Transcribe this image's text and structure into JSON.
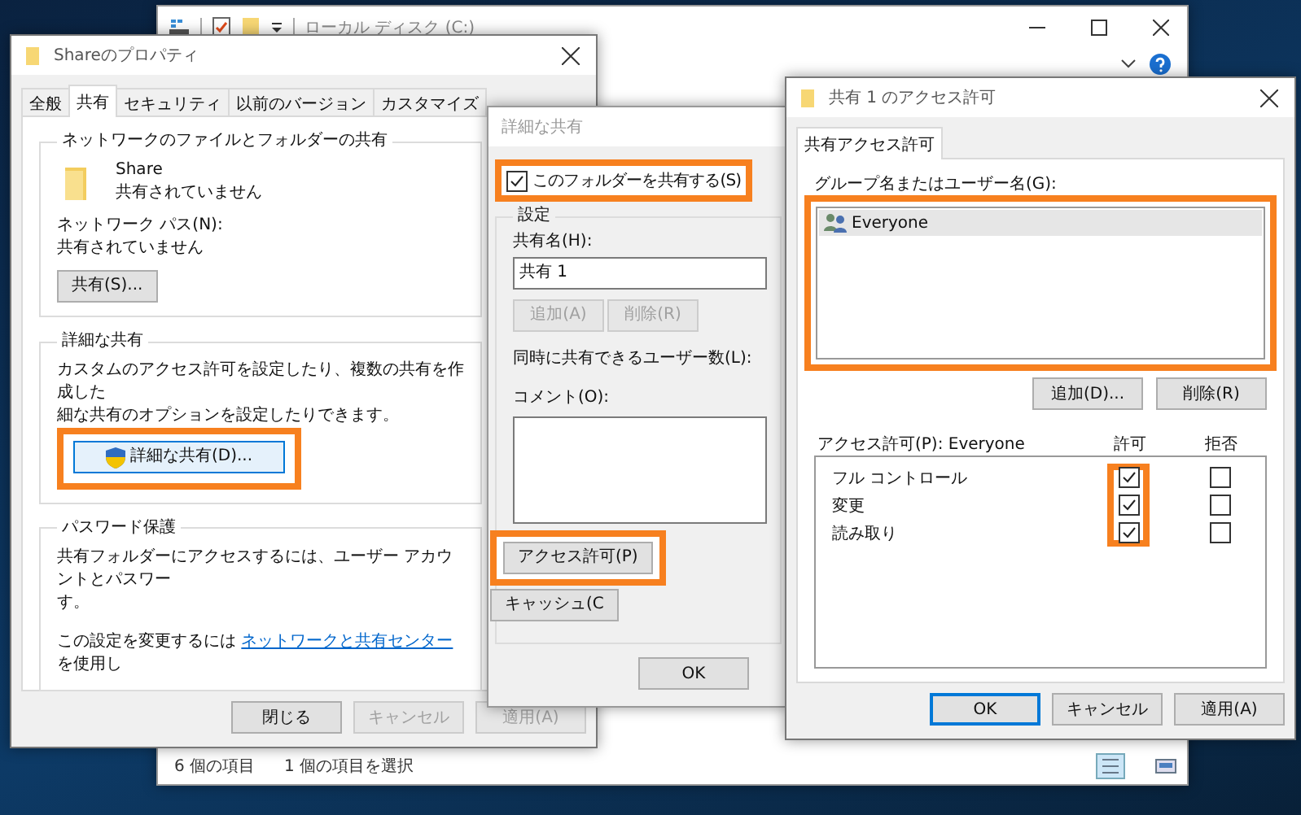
{
  "explorer": {
    "title": "ローカル ディスク (C:)",
    "status_items": [
      "6 個の項目",
      "1 個の項目を選択"
    ]
  },
  "properties": {
    "title": "Shareのプロパティ",
    "tabs": [
      {
        "label": "全般",
        "selected": false
      },
      {
        "label": "共有",
        "selected": true
      },
      {
        "label": "セキュリティ",
        "selected": false
      },
      {
        "label": "以前のバージョン",
        "selected": false
      },
      {
        "label": "カスタマイズ",
        "selected": false
      }
    ],
    "network_group": {
      "title": "ネットワークのファイルとフォルダーの共有",
      "folder_name": "Share",
      "folder_status": "共有されていません",
      "path_label": "ネットワーク パス(N):",
      "path_value": "共有されていません",
      "button": "共有(S)..."
    },
    "advanced_group": {
      "title": "詳細な共有",
      "description": [
        "カスタムのアクセス許可を設定したり、複数の共有を作成した",
        "細な共有のオプションを設定したりできます。"
      ],
      "button": {
        "label": "詳細な共有(D)...",
        "highlighted": true
      }
    },
    "password_group": {
      "title": "パスワード保護",
      "description": [
        "共有フォルダーにアクセスするには、ユーザー アカウントとパスワー",
        "す。"
      ],
      "change_text": "この設定を変更するには",
      "link": "ネットワークと共有センター",
      "change_suffix": "を使用し"
    },
    "buttons": [
      {
        "label": "閉じる",
        "disabled": false
      },
      {
        "label": "キャンセル",
        "disabled": true
      },
      {
        "label": "適用(A)",
        "disabled": true
      }
    ]
  },
  "advanced_dialog": {
    "title": "詳細な共有",
    "share_checkbox": {
      "label": "このフォルダーを共有する(S)",
      "checked": true,
      "highlighted": true
    },
    "settings_title": "設定",
    "share_name_label": "共有名(H):",
    "share_name_value": "共有 1",
    "name_buttons": [
      {
        "label": "追加(A)",
        "disabled": true
      },
      {
        "label": "削除(R)",
        "disabled": true
      }
    ],
    "user_limit_label": "同時に共有できるユーザー数(L):",
    "comment_label": "コメント(O):",
    "permission_button": {
      "label": "アクセス許可(P)",
      "highlighted": true
    },
    "cache_button": "キャッシュ(C",
    "ok_button": "OK"
  },
  "permissions_dialog": {
    "title": "共有 1 のアクセス許可",
    "tab": "共有アクセス許可",
    "group_label": "グループ名またはユーザー名(G):",
    "users": [
      {
        "name": "Everyone",
        "selected": true
      }
    ],
    "users_highlighted": true,
    "user_buttons": [
      "追加(D)...",
      "削除(R)"
    ],
    "permissions_label": "アクセス許可(P): Everyone",
    "allow_header": "許可",
    "deny_header": "拒否",
    "allow_highlighted": true,
    "permissions": [
      {
        "name": "フル コントロール",
        "allow": true,
        "deny": false
      },
      {
        "name": "変更",
        "allow": true,
        "deny": false
      },
      {
        "name": "読み取り",
        "allow": true,
        "deny": false
      }
    ],
    "buttons": [
      {
        "label": "OK",
        "default": true
      },
      {
        "label": "キャンセル",
        "default": false
      },
      {
        "label": "適用(A)",
        "default": false
      }
    ]
  }
}
